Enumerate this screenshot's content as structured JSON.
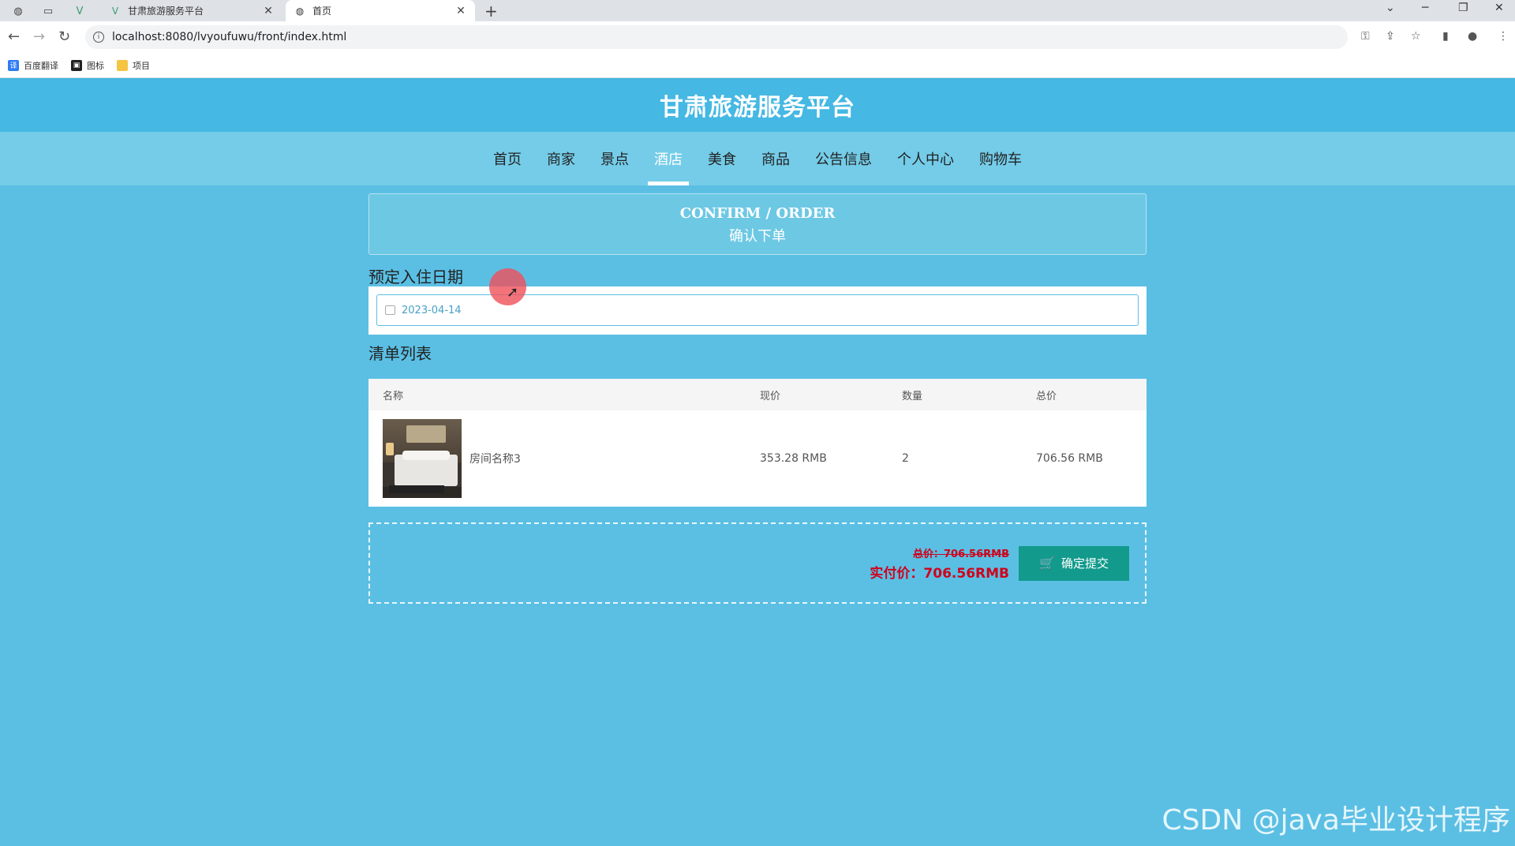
{
  "browser": {
    "tabs": [
      {
        "title": "甘肃旅游服务平台",
        "favicon": "vue-logo-icon",
        "active": false
      },
      {
        "title": "首页",
        "favicon": "globe-icon",
        "active": true
      }
    ],
    "url": "localhost:8080/lvyoufuwu/front/index.html",
    "bookmarks": [
      {
        "label": "百度翻译",
        "color": "#2e7cf6"
      },
      {
        "label": "图标",
        "color": "#222222"
      },
      {
        "label": "项目",
        "color": "#f5c542"
      }
    ]
  },
  "site": {
    "title": "甘肃旅游服务平台",
    "nav": [
      "首页",
      "商家",
      "景点",
      "酒店",
      "美食",
      "商品",
      "公告信息",
      "个人中心",
      "购物车"
    ],
    "active_nav": "酒店"
  },
  "confirm": {
    "en": "CONFIRM / ORDER",
    "cn": "确认下单"
  },
  "checkin": {
    "label": "预定入住日期",
    "date": "2023-04-14"
  },
  "list": {
    "label": "清单列表",
    "headers": [
      "名称",
      "现价",
      "数量",
      "总价"
    ],
    "rows": [
      {
        "name": "房间名称3",
        "price": "353.28 RMB",
        "qty": "2",
        "total": "706.56 RMB"
      }
    ]
  },
  "summary": {
    "total_label": "总价：706.56RMB",
    "actual_label": "实付价：706.56RMB",
    "submit_label": "确定提交"
  },
  "watermark": "CSDN @java毕业设计程序",
  "colors": {
    "header": "#45b8e3",
    "nav": "#74cce8",
    "button": "#129a8c",
    "price_red": "#d0021b"
  }
}
